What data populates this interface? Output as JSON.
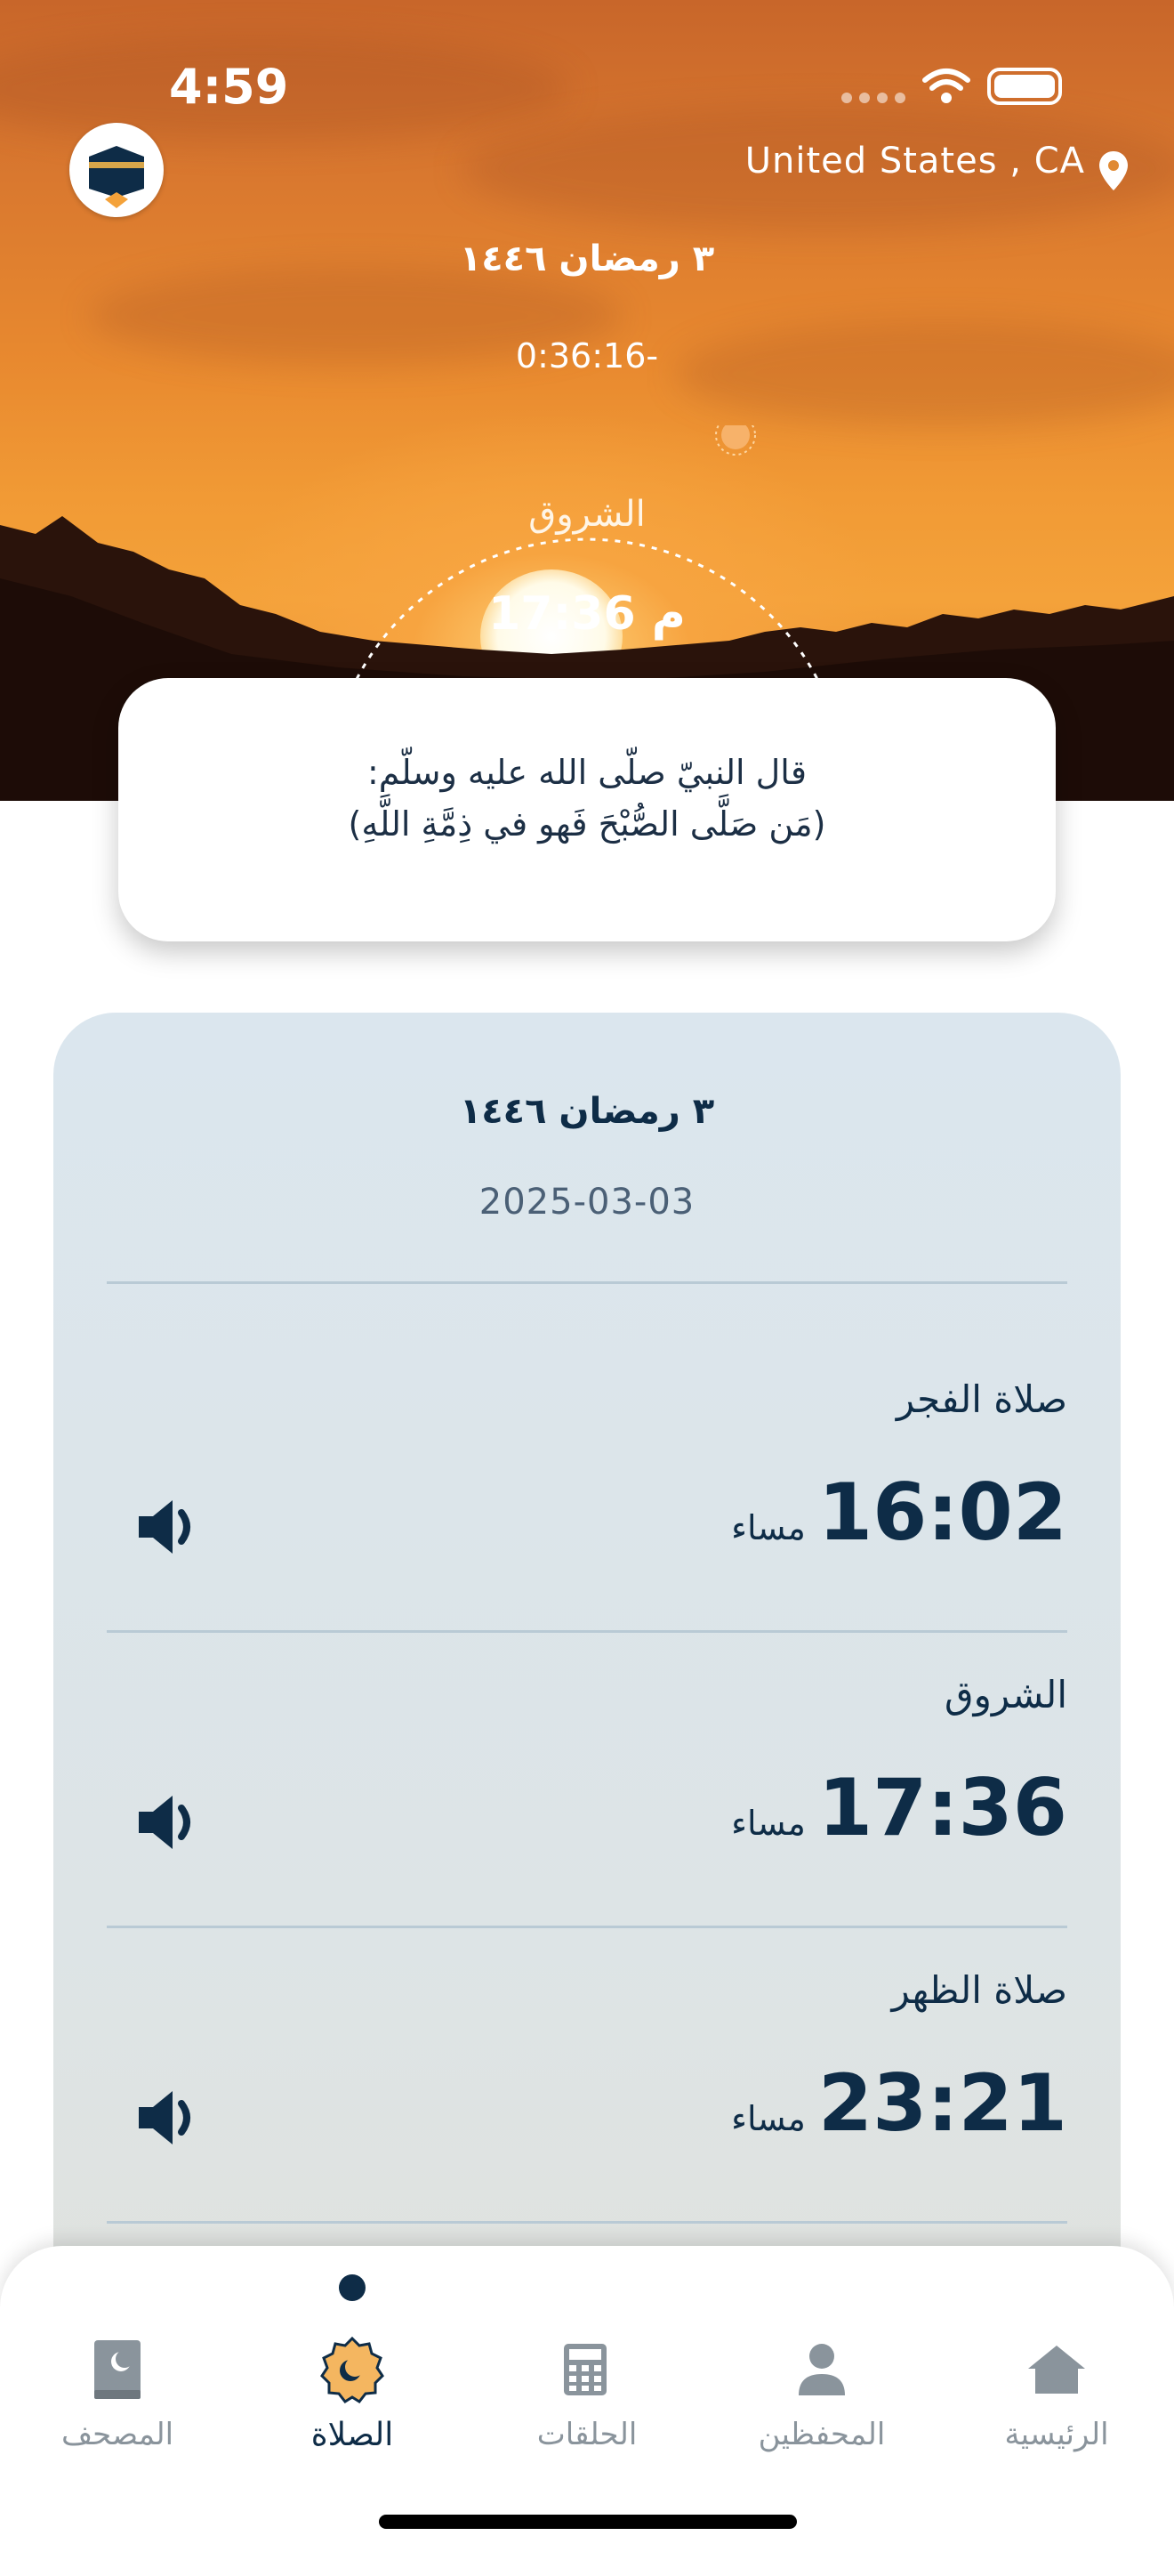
{
  "status_bar": {
    "time": "4:59"
  },
  "header": {
    "location": "United States , CA",
    "hijri_date": "٣ رمضان ١٤٤٦",
    "countdown": "0:36:16-",
    "next_prayer_name": "الشروق",
    "next_prayer_time": "17:36 م",
    "next_prayer_time_visible": "17:36"
  },
  "quote": {
    "line1": "قال النبيّ صلّى الله عليه وسلّم:",
    "line2": "(مَن صَلَّى الصُّبْحَ فَهو في ذِمَّةِ اللَّهِ)"
  },
  "times_card": {
    "hijri_date": "٣ رمضان ١٤٤٦",
    "gregorian_date": "2025-03-03",
    "prayers": [
      {
        "name": "صلاة الفجر",
        "time": "16:02",
        "period": "مساء"
      },
      {
        "name": "الشروق",
        "time": "17:36",
        "period": "مساء"
      },
      {
        "name": "صلاة الظهر",
        "time": "23:21",
        "period": "مساء"
      }
    ]
  },
  "tabbar": {
    "active": "الصلاة",
    "tabs": [
      {
        "label": "المصحف",
        "icon": "quran-icon"
      },
      {
        "label": "الصلاة",
        "icon": "prayer-icon"
      },
      {
        "label": "الحلقات",
        "icon": "calculator-icon"
      },
      {
        "label": "المحفظين",
        "icon": "person-icon"
      },
      {
        "label": "الرئيسية",
        "icon": "home-icon"
      }
    ]
  },
  "colors": {
    "primary": "#0e2c47",
    "inactive": "#8a949c",
    "accent": "#f4a23a"
  }
}
